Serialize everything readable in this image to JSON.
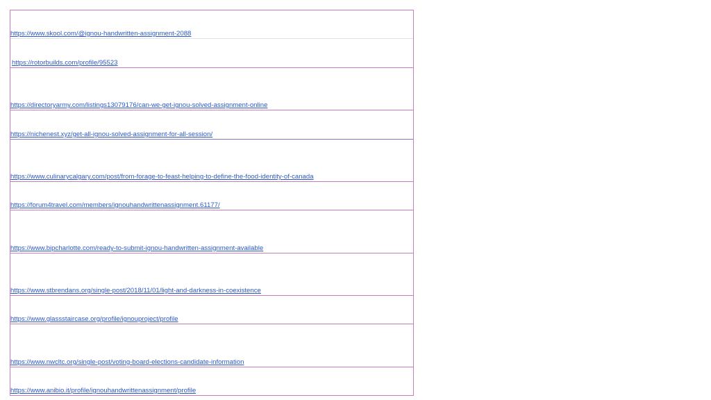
{
  "links": [
    "https://www.skool.com/@ignou-handwritten-assignment-2088",
    "https://rotorbuilds.com/profile/95523",
    "https://directoryarmy.com/listings13079176/can-we-get-ignou-solved-assignment-online",
    "https://nichenest.xyz/get-all-ignou-solved-assignment-for-all-session/",
    "https://www.culinarycalgary.com/post/from-forage-to-feast-helping-to-define-the-food-identity-of-canada",
    "https://forum4travel.com/members/ignouhandwrittenassignment.61177/",
    "https://www.bipcharlotte.com/ready-to-submit-ignou-handwritten-assignment-available",
    "https://www.stbrendans.org/single-post/2018/11/01/light-and-darkness-in-coexistence",
    "https://www.glassstaircase.org/profile/ignouproject/profile",
    "https://www.nwcltc.org/single-post/voting-board-elections-candidate-information",
    "https://www.anibio.it/profile/ignouhandwrittenassignment/profile"
  ],
  "colors": {
    "link": "#2b58c4",
    "grid_line": "#c77cbd",
    "light_grid_line": "#e2e2e2",
    "blue_grid_line": "#7a78c8"
  }
}
